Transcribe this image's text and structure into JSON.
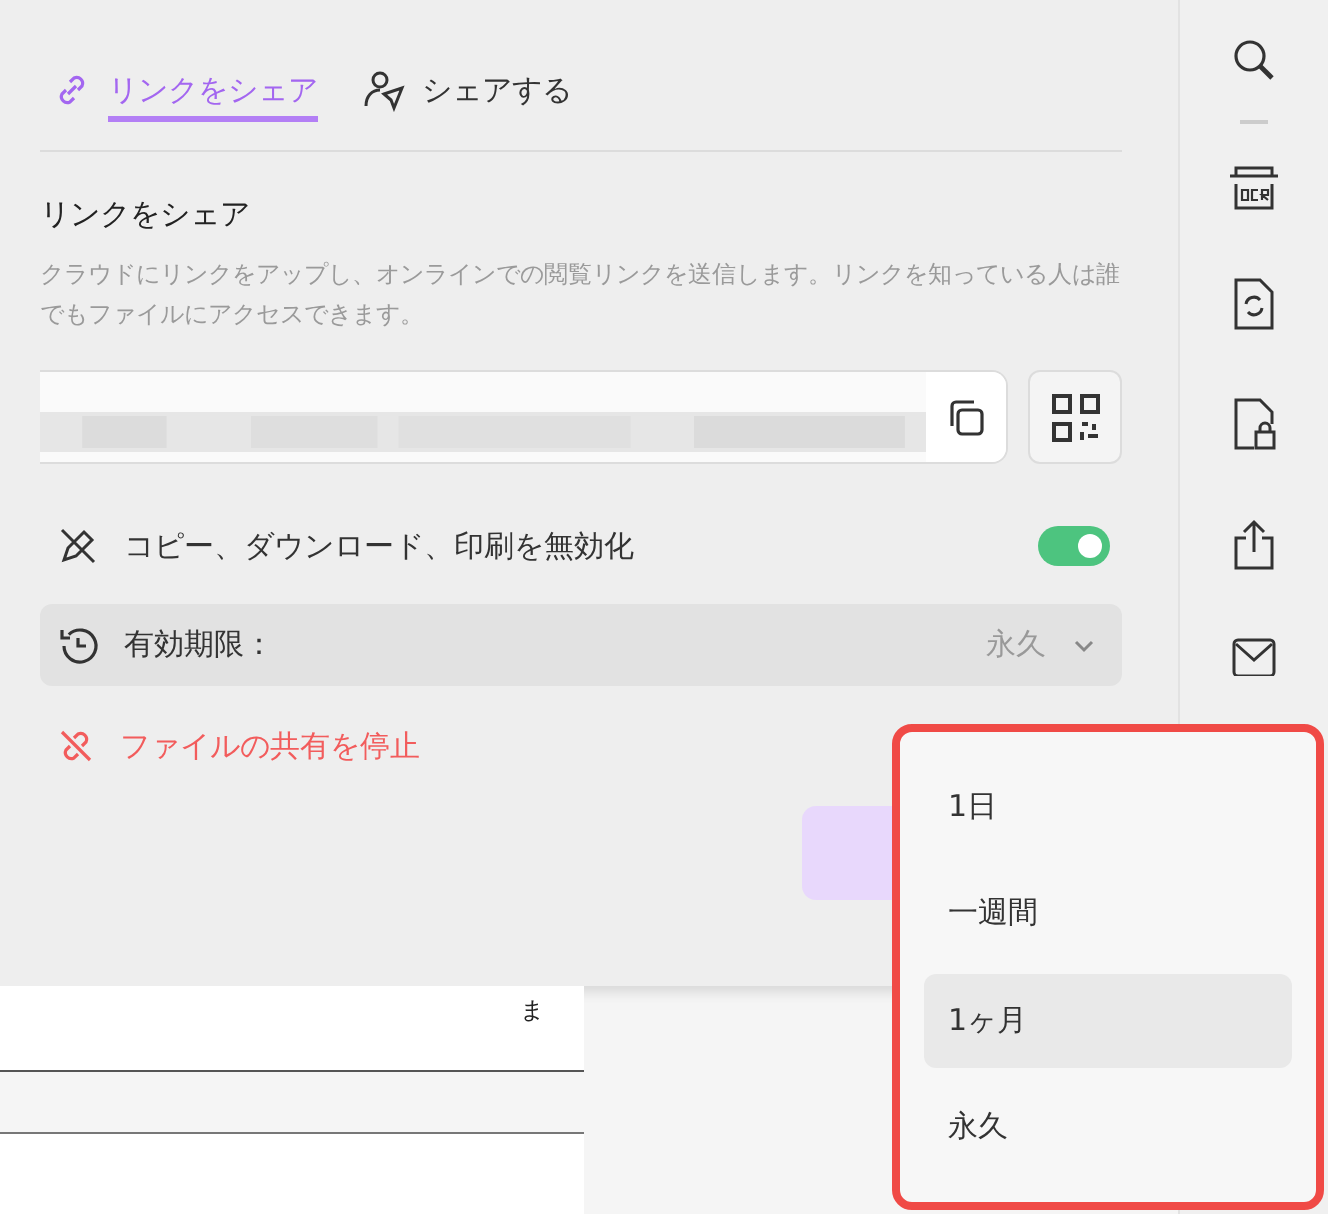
{
  "tabs": [
    {
      "label": "リンクをシェア",
      "kind": "link",
      "selected": true
    },
    {
      "label": "シェアする",
      "kind": "person",
      "selected": false
    }
  ],
  "share_link": {
    "title": "リンクをシェア",
    "description": "クラウドにリンクをアップし、オンラインでの閲覧リンクを送信します。リンクを知っている人は誰でもファイルにアクセスできます。"
  },
  "disable_copy": {
    "label": "コピー、ダウンロード、印刷を無効化",
    "on": true
  },
  "expiry": {
    "label": "有効期限：",
    "value": "永久",
    "expanded": true
  },
  "stop_sharing": {
    "label": "ファイルの共有を停止"
  },
  "document": {
    "text": "ま"
  },
  "expiry_options": [
    {
      "label": "1日",
      "highlighted": false
    },
    {
      "label": "一週間",
      "highlighted": false
    },
    {
      "label": "1ヶ月",
      "highlighted": true
    },
    {
      "label": "永久",
      "highlighted": false
    }
  ]
}
